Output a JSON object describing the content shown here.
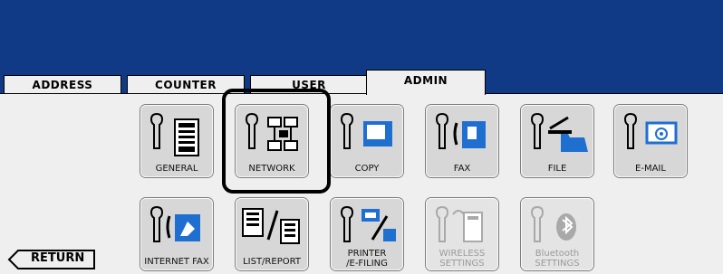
{
  "tabs": [
    {
      "label": "ADDRESS",
      "active": false
    },
    {
      "label": "COUNTER",
      "active": false
    },
    {
      "label": "USER",
      "active": false
    },
    {
      "label": "ADMIN",
      "active": true
    }
  ],
  "menu": {
    "row1": [
      {
        "label": "GENERAL",
        "icon": "general-icon"
      },
      {
        "label": "NETWORK",
        "icon": "network-icon",
        "highlighted": true
      },
      {
        "label": "COPY",
        "icon": "copy-icon"
      },
      {
        "label": "FAX",
        "icon": "fax-icon"
      },
      {
        "label": "FILE",
        "icon": "file-icon"
      },
      {
        "label": "E-MAIL",
        "icon": "email-icon"
      }
    ],
    "row2": [
      {
        "label": "INTERNET FAX",
        "icon": "internet-fax-icon"
      },
      {
        "label": "LIST/REPORT",
        "icon": "list-report-icon"
      },
      {
        "label": "PRINTER\n/E-FILING",
        "icon": "printer-efiling-icon"
      },
      {
        "label": "WIRELESS\nSETTINGS",
        "icon": "wireless-icon",
        "disabled": true
      },
      {
        "label": "Bluetooth\nSETTINGS",
        "icon": "bluetooth-icon",
        "disabled": true
      }
    ]
  },
  "return_label": "RETURN",
  "colors": {
    "header_bg": "#103a86",
    "panel_bg": "#efefef",
    "tile_bg": "#d7d7d7",
    "accent": "#1f6fd1"
  }
}
